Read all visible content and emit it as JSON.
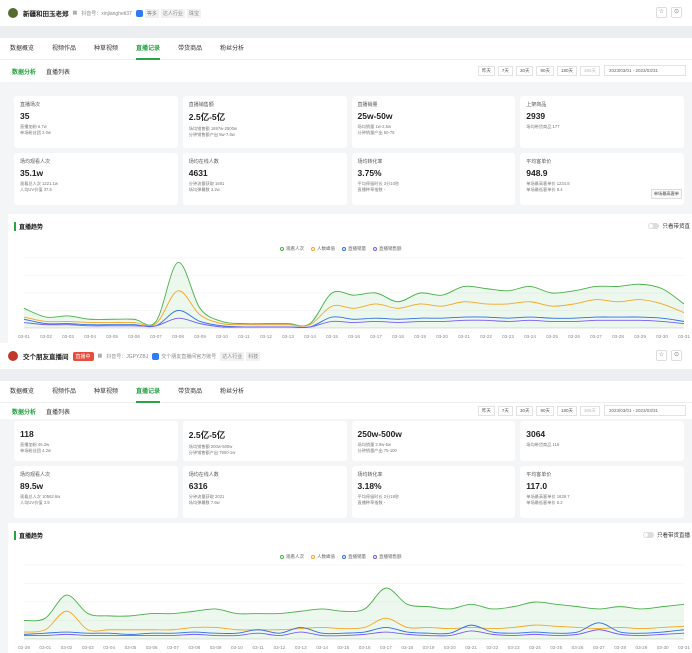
{
  "panels": [
    {
      "account": {
        "avatar_color": "#556b2f",
        "name": "新疆和田玉老郑",
        "douyin_id": "抖音号：xinjiangheti37",
        "tags": [
          "等多",
          "达人行业",
          "珠宝"
        ],
        "live_tag": null,
        "verified_text": null
      },
      "main_tabs": [
        "数据概览",
        "视频作品",
        "种草视频",
        "直播记录",
        "带货商品",
        "粉丝分析"
      ],
      "main_tab_active": 3,
      "sub_tabs": [
        "数据分析",
        "直播列表"
      ],
      "ranges": [
        "昨天",
        "7天",
        "30天",
        "90天",
        "180天",
        "365天"
      ],
      "date_range": "2023/03/01 - 2023/03/31",
      "cards": [
        {
          "title": "直播场次",
          "value": "35",
          "subs": [
            "直播加粉 6.7w",
            "单场粉丝团 2.0w"
          ]
        },
        {
          "title": "直播销售额",
          "value": "2.5亿-5亿",
          "subs": [
            "场均销售额 1697w-2500w",
            "分钟销售额产出 5w-7.6w"
          ]
        },
        {
          "title": "直播销量",
          "value": "25w-50w",
          "subs": [
            "场均销量 1w-2.5w",
            "分钟销量产出 50-75"
          ]
        },
        {
          "title": "上架商品",
          "value": "2939",
          "subs": [
            "场均带货商品 177"
          ]
        },
        {
          "title": "场均观看人次",
          "value": "35.1w",
          "subs": [
            "观看总人次 1221.1w",
            "人均UV价值 37.5"
          ]
        },
        {
          "title": "场均在线人数",
          "value": "4631",
          "subs": [
            "分钟流量获取 1681",
            "场均弹幕数 3.2w"
          ]
        },
        {
          "title": "场均转化率",
          "value": "3.75%",
          "subs": [
            "平均停留时长 3分10秒",
            "直播种草指数 -"
          ]
        },
        {
          "title": "平均客单价",
          "value": "948.9",
          "subs": [
            "单场最高客单价 1234.8",
            "单场最低客单价 8.4"
          ],
          "button": "单场最高客单"
        }
      ],
      "trend_title": "直播趋势",
      "toggle_label": "只看带货直",
      "legend": [
        "观看人次",
        "人数峰值",
        "直播销量",
        "直播销售额"
      ],
      "chart_data": {
        "type": "line",
        "x": [
          "03-01",
          "03-02",
          "03-03",
          "03-04",
          "03-05",
          "03-06",
          "03-07",
          "03-08",
          "03-09",
          "03-10",
          "03-11",
          "03-12",
          "03-13",
          "03-14",
          "03-15",
          "03-16",
          "03-17",
          "03-18",
          "03-19",
          "03-20",
          "03-21",
          "03-22",
          "03-23",
          "03-24",
          "03-25",
          "03-26",
          "03-27",
          "03-28",
          "03-29",
          "03-30",
          "03-31"
        ],
        "series": [
          {
            "name": "观看人次",
            "color": "#49b04a",
            "fill": true,
            "values": [
              18,
              10,
              11,
              8,
              8,
              8,
              6,
              60,
              18,
              6,
              4,
              4,
              4,
              4,
              32,
              30,
              32,
              24,
              32,
              30,
              38,
              36,
              34,
              38,
              32,
              34,
              38,
              38,
              40,
              36,
              22
            ]
          },
          {
            "name": "人数峰值",
            "color": "#f5a623",
            "fill": false,
            "values": [
              10,
              6,
              6,
              5,
              5,
              5,
              4,
              34,
              12,
              4,
              3,
              3,
              3,
              3,
              20,
              18,
              22,
              18,
              22,
              20,
              24,
              22,
              22,
              24,
              20,
              22,
              26,
              24,
              26,
              22,
              14
            ]
          },
          {
            "name": "直播销量",
            "color": "#2f6fe4",
            "fill": false,
            "values": [
              8,
              4,
              4,
              3,
              3,
              3,
              2,
              16,
              6,
              2,
              1,
              1,
              1,
              1,
              10,
              8,
              9,
              8,
              9,
              9,
              10,
              10,
              9,
              10,
              9,
              9,
              10,
              10,
              10,
              9,
              6
            ]
          },
          {
            "name": "直播销售额",
            "color": "#7a5af5",
            "fill": false,
            "values": [
              5,
              3,
              3,
              2,
              2,
              2,
              2,
              9,
              4,
              1,
              1,
              1,
              1,
              1,
              6,
              5,
              6,
              5,
              6,
              6,
              7,
              7,
              6,
              7,
              6,
              6,
              7,
              7,
              7,
              6,
              4
            ]
          }
        ]
      }
    },
    {
      "account": {
        "avatar_color": "#c0392b",
        "name": "交个朋友直播间",
        "douyin_id": "抖音号：JGPYZBJ",
        "tags": [
          "达人行业",
          "科技"
        ],
        "live_tag": "直播中",
        "verified_text": "交个朋友直播间官方账号"
      },
      "main_tabs": [
        "数据概览",
        "视频作品",
        "种草视频",
        "直播记录",
        "带货商品",
        "粉丝分析"
      ],
      "main_tab_active": 3,
      "sub_tabs": [
        "数据分析",
        "直播列表"
      ],
      "ranges": [
        "昨天",
        "7天",
        "30天",
        "90天",
        "180天",
        "365天"
      ],
      "date_range": "2023/03/01 - 2023/03/31",
      "cards": [
        {
          "title": "",
          "value": "118",
          "subs": [
            "直播加粉 45.3w",
            "单场粉丝团 4.2w"
          ]
        },
        {
          "title": "",
          "value": "2.5亿-5亿",
          "subs": [
            "场均销售额 200w-500w",
            "分钟销售额产出 7900-1w"
          ]
        },
        {
          "title": "",
          "value": "250w-500w",
          "subs": [
            "场均销量 2.9w-5w",
            "分钟销量产出 75-100"
          ]
        },
        {
          "title": "",
          "value": "3064",
          "subs": [
            "场均带货商品 116"
          ]
        },
        {
          "title": "场均观看人次",
          "value": "89.5w",
          "subs": [
            "观看总人次 10562.6w",
            "人均UV价值 3.9"
          ]
        },
        {
          "title": "场均在线人数",
          "value": "6316",
          "subs": [
            "分钟流量获取 2021",
            "场均弹幕数 7.6w"
          ]
        },
        {
          "title": "场均转化率",
          "value": "3.18%",
          "subs": [
            "平均停留时长 2分18秒",
            "直播种草指数 -"
          ]
        },
        {
          "title": "平均客单价",
          "value": "117.0",
          "subs": [
            "单场最高客单价 1639.7",
            "单场最低客单价 6.2"
          ]
        }
      ],
      "trend_title": "直播趋势",
      "toggle_label": "只看带货直播",
      "legend": [
        "观看人次",
        "人数峰值",
        "直播销量",
        "直播销售额"
      ],
      "chart_data": {
        "type": "line",
        "x": [
          "02-28",
          "03-01",
          "03-02",
          "03-03",
          "03-04",
          "03-05",
          "03-06",
          "03-07",
          "03-08",
          "03-09",
          "03-10",
          "03-11",
          "03-12",
          "03-13",
          "03-14",
          "03-15",
          "03-16",
          "03-17",
          "03-18",
          "03-19",
          "03-20",
          "03-21",
          "03-22",
          "03-23",
          "03-24",
          "03-25",
          "03-26",
          "03-27",
          "03-28",
          "03-29",
          "03-30",
          "03-31"
        ],
        "series": [
          {
            "name": "观看人次",
            "color": "#49b04a",
            "fill": true,
            "values": [
              16,
              18,
              38,
              22,
              20,
              20,
              22,
              22,
              24,
              26,
              22,
              22,
              22,
              24,
              26,
              24,
              26,
              44,
              30,
              28,
              26,
              30,
              26,
              28,
              32,
              30,
              28,
              26,
              28,
              26,
              28,
              30
            ]
          },
          {
            "name": "人数峰值",
            "color": "#f5a623",
            "fill": false,
            "values": [
              6,
              8,
              24,
              8,
              8,
              8,
              8,
              8,
              10,
              10,
              8,
              8,
              8,
              9,
              10,
              9,
              10,
              18,
              10,
              10,
              9,
              10,
              9,
              10,
              12,
              11,
              10,
              9,
              10,
              9,
              10,
              11
            ]
          },
          {
            "name": "直播销量",
            "color": "#2f6fe4",
            "fill": false,
            "values": [
              4,
              5,
              6,
              5,
              5,
              4,
              5,
              5,
              6,
              5,
              5,
              8,
              5,
              10,
              5,
              5,
              6,
              10,
              6,
              5,
              5,
              12,
              6,
              5,
              6,
              5,
              6,
              14,
              6,
              5,
              6,
              8
            ]
          },
          {
            "name": "直播销售额",
            "color": "#7a5af5",
            "fill": false,
            "values": [
              3,
              3,
              4,
              3,
              3,
              3,
              3,
              3,
              4,
              3,
              3,
              5,
              3,
              6,
              3,
              3,
              4,
              6,
              4,
              3,
              3,
              7,
              4,
              3,
              4,
              3,
              4,
              8,
              4,
              3,
              4,
              5
            ]
          }
        ]
      }
    }
  ]
}
